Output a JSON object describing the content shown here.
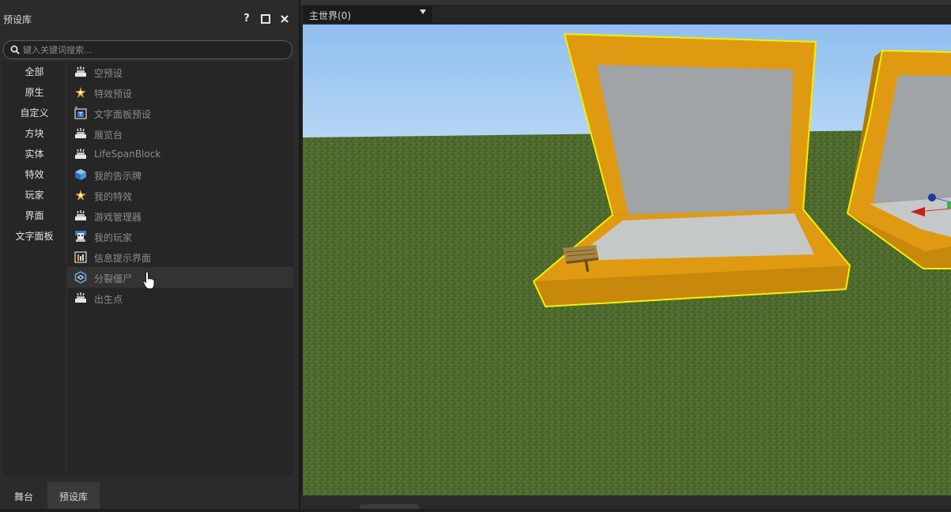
{
  "panel": {
    "title": "预设库",
    "help_label": "?",
    "search_placeholder": "键入关键词搜索...",
    "categories": [
      "全部",
      "原生",
      "自定义",
      "方块",
      "实体",
      "特效",
      "玩家",
      "界面",
      "文字面板"
    ],
    "items": [
      {
        "label": "空预设",
        "icon": "anvil-icon"
      },
      {
        "label": "特效预设",
        "icon": "sparkle-icon"
      },
      {
        "label": "文字面板预设",
        "icon": "text-panel-icon"
      },
      {
        "label": "展览台",
        "icon": "anvil-icon"
      },
      {
        "label": "LifeSpanBlock",
        "icon": "anvil-icon"
      },
      {
        "label": "我的告示牌",
        "icon": "cube-icon"
      },
      {
        "label": "我的特效",
        "icon": "sparkle-icon"
      },
      {
        "label": "游戏管理器",
        "icon": "anvil-icon"
      },
      {
        "label": "我的玩家",
        "icon": "player-icon"
      },
      {
        "label": "信息提示界面",
        "icon": "ui-screen-icon"
      },
      {
        "label": "分裂僵尸",
        "icon": "entity-hex-icon"
      },
      {
        "label": "出生点",
        "icon": "anvil-icon"
      }
    ],
    "bottom_tabs": [
      "舞台",
      "预设库"
    ],
    "active_bottom_tab": "预设库"
  },
  "viewport": {
    "dimension_select": "主世界(0)"
  },
  "colors": {
    "frame_gold": "#e09a12",
    "frame_dark": "#b07a0a",
    "selection_outline": "#f3f000",
    "grass": "#4e6a2e",
    "sky": "#a6cdf2"
  }
}
